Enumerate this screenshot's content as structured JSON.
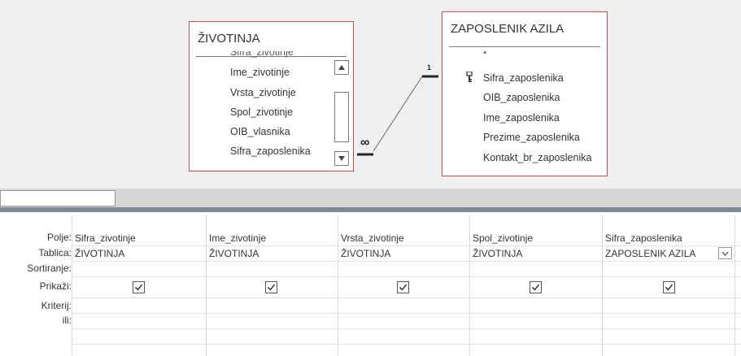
{
  "tables": [
    {
      "title": "ŽIVOTINJA",
      "partial_top_field": "Sifra_zivotinje",
      "fields": [
        "Ime_zivotinje",
        "Vrsta_zivotinje",
        "Spol_zivotinje",
        "OIB_vlasnika",
        "Sifra_zaposlenika"
      ]
    },
    {
      "title": "ZAPOSLENIK AZILA",
      "fields": [
        "*",
        "Sifra_zaposlenika",
        "OIB_zaposlenika",
        "Ime_zaposlenika",
        "Prezime_zaposlenika",
        "Kontakt_br_zaposlenika"
      ],
      "key_field": "Sifra_zaposlenika"
    }
  ],
  "relationship": {
    "one_label": "1",
    "many_label": "∞"
  },
  "name_box": {
    "value": ""
  },
  "grid": {
    "row_labels": [
      "Polje:",
      "Tablica:",
      "Sortiranje:",
      "Prikaži:",
      "Kriterij:",
      "ili:"
    ],
    "columns": [
      {
        "field": "Sifra_zivotinje",
        "table": "ŽIVOTINJA",
        "sort": "",
        "show": true
      },
      {
        "field": "Ime_zivotinje",
        "table": "ŽIVOTINJA",
        "sort": "",
        "show": true
      },
      {
        "field": "Vrsta_zivotinje",
        "table": "ŽIVOTINJA",
        "sort": "",
        "show": true
      },
      {
        "field": "Spol_zivotinje",
        "table": "ŽIVOTINJA",
        "sort": "",
        "show": true
      },
      {
        "field": "Sifra_zaposlenika",
        "table": "ZAPOSLENIK AZILA",
        "sort": "",
        "show": true
      }
    ]
  },
  "colors": {
    "table_border": "#c0504d",
    "splitter": "#7f8a99",
    "background": "#f0f0f0"
  },
  "icons": {
    "key": "key-icon",
    "scroll_up": "scroll-up-icon",
    "scroll_down": "scroll-down-icon",
    "dropdown": "chevron-down-icon",
    "check": "checkmark-icon"
  }
}
